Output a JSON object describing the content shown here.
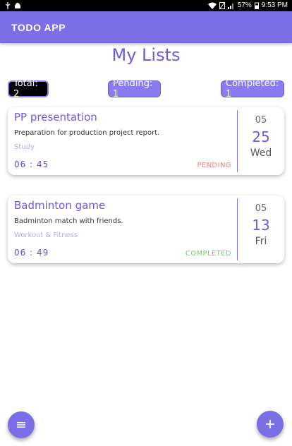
{
  "status_bar": {
    "battery": "57%",
    "time": "9:53 PM"
  },
  "app_bar": {
    "title": "TODO APP"
  },
  "page": {
    "title": "My Lists"
  },
  "counters": {
    "total": "Total: 2",
    "pending": "Pending: 1",
    "completed": "Completed: 1"
  },
  "tasks": [
    {
      "title": "PP presentation",
      "description": "Preparation for production project report.",
      "category": "Study",
      "time": "06 : 45",
      "status": "PENDING",
      "month": "05",
      "day": "25",
      "weekday": "Wed"
    },
    {
      "title": "Badminton game",
      "description": "Badminton match with friends.",
      "category": "Workout & Fitness",
      "time": "06 : 49",
      "status": "COMPLETED",
      "month": "05",
      "day": "13",
      "weekday": "Fri"
    }
  ],
  "icons": {
    "fab_left": "menu-icon",
    "fab_right": "add-icon"
  },
  "colors": {
    "primary": "#7b6ee6",
    "pending": "#f08080",
    "completed": "#6fcf73"
  }
}
